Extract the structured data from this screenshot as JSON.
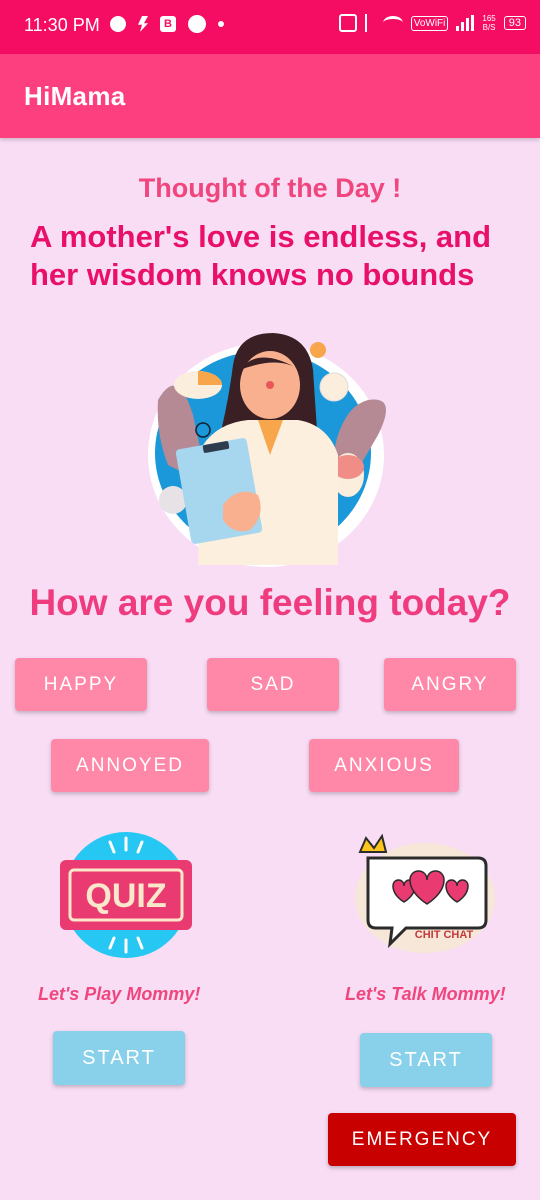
{
  "status_bar": {
    "time": "11:30 PM",
    "left_icons": [
      "chat-bubble-icon",
      "bolt-icon",
      "b-app-icon",
      "circle-icon",
      "dot-icon"
    ],
    "vowifi": "VoWiFi",
    "speed_value": "165",
    "speed_unit": "B/S",
    "battery": "93"
  },
  "app_bar": {
    "title": "HiMama"
  },
  "thought": {
    "title": "Thought of the Day !",
    "text": "A mother's love is endless, and her wisdom knows no bounds"
  },
  "feeling": {
    "title": "How are you feeling today?",
    "moods": [
      "HAPPY",
      "SAD",
      "ANGRY",
      "ANNOYED",
      "ANXIOUS"
    ]
  },
  "quiz": {
    "badge_text": "QUIZ",
    "caption": "Let's Play Mommy!",
    "button": "START"
  },
  "chat": {
    "badge_text": "CHIT CHAT",
    "caption": "Let's Talk Mommy!",
    "button": "START"
  },
  "emergency": {
    "label": "EMERGENCY"
  },
  "colors": {
    "status_bar": "#F50D63",
    "app_bar": "#FD3E7F",
    "background": "#F8DDF5",
    "mood_button": "#FF88A9",
    "start_button": "#89D0EA",
    "emergency_button": "#C90000",
    "accent_text": "#E8106A"
  }
}
